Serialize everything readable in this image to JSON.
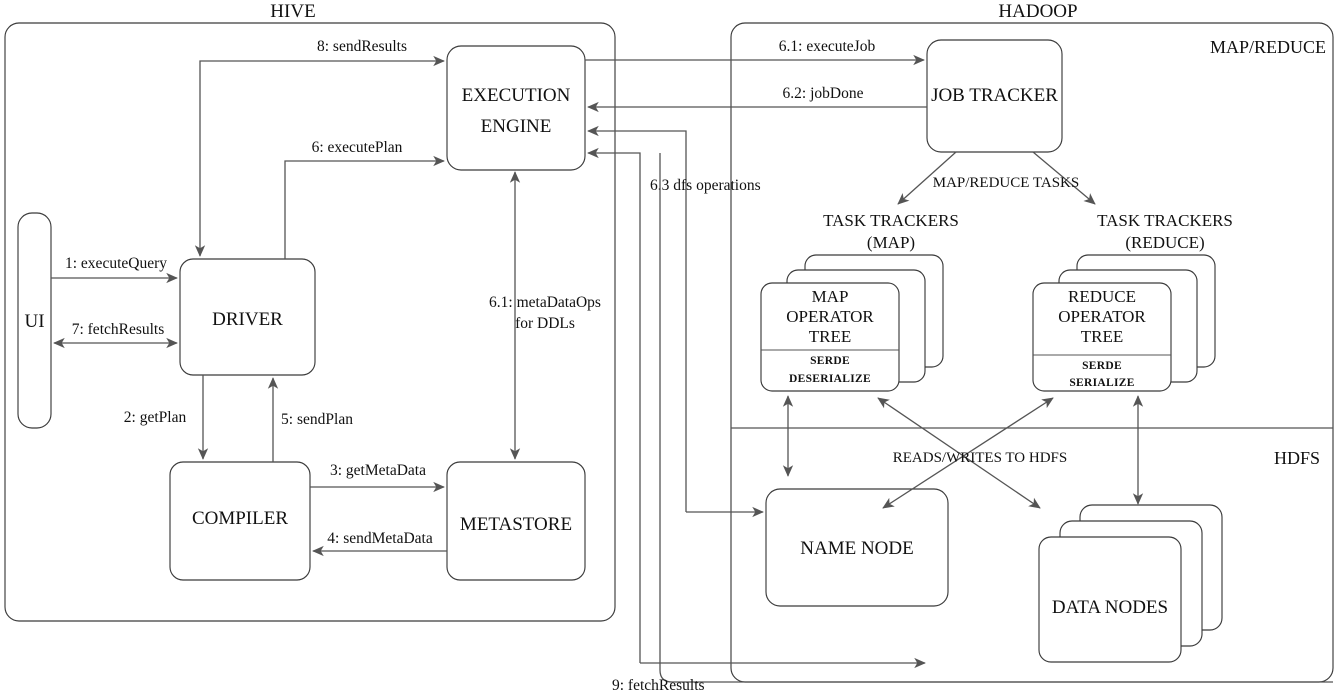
{
  "diagram": {
    "title_hive": "HIVE",
    "title_hadoop": "HADOOP",
    "zone_mapreduce": "MAP/REDUCE",
    "zone_hdfs": "HDFS"
  },
  "nodes": {
    "ui": "UI",
    "driver": "DRIVER",
    "compiler": "COMPILER",
    "metastore": "METASTORE",
    "execution_engine_line1": "EXECUTION",
    "execution_engine_line2": "ENGINE",
    "job_tracker": "JOB TRACKER",
    "task_trackers_map_line1": "TASK TRACKERS",
    "task_trackers_map_line2": "(MAP)",
    "task_trackers_reduce_line1": "TASK TRACKERS",
    "task_trackers_reduce_line2": "(REDUCE)",
    "map_operator_tree_line1": "MAP",
    "map_operator_tree_line2": "OPERATOR",
    "map_operator_tree_line3": "TREE",
    "map_serde_line1": "SERDE",
    "map_serde_line2": "DESERIALIZE",
    "reduce_operator_tree_line1": "REDUCE",
    "reduce_operator_tree_line2": "OPERATOR",
    "reduce_operator_tree_line3": "TREE",
    "reduce_serde_line1": "SERDE",
    "reduce_serde_line2": "SERIALIZE",
    "name_node": "NAME NODE",
    "data_nodes": "DATA NODES"
  },
  "edges": {
    "e1_execute_query": "1: executeQuery",
    "e2_get_plan": "2: getPlan",
    "e3_get_metadata": "3: getMetaData",
    "e4_send_metadata": "4: sendMetaData",
    "e5_send_plan": "5: sendPlan",
    "e6_execute_plan": "6: executePlan",
    "e6_1_metadata_ops_line1": "6.1: metaDataOps",
    "e6_1_metadata_ops_line2": "for DDLs",
    "e6_1_execute_job": "6.1: executeJob",
    "e6_2_job_done": "6.2: jobDone",
    "e6_3_dfs_operations": "6.3 dfs operations",
    "e7_fetch_results": "7: fetchResults",
    "e8_send_results": "8: sendResults",
    "e9_fetch_results": "9: fetchResults",
    "map_reduce_tasks": "MAP/REDUCE TASKS",
    "reads_writes_to_hdfs": "READS/WRITES TO HDFS"
  },
  "colors": {
    "stroke": "#3a3a3a",
    "connector": "#555555",
    "text": "#111111",
    "background": "#ffffff"
  }
}
